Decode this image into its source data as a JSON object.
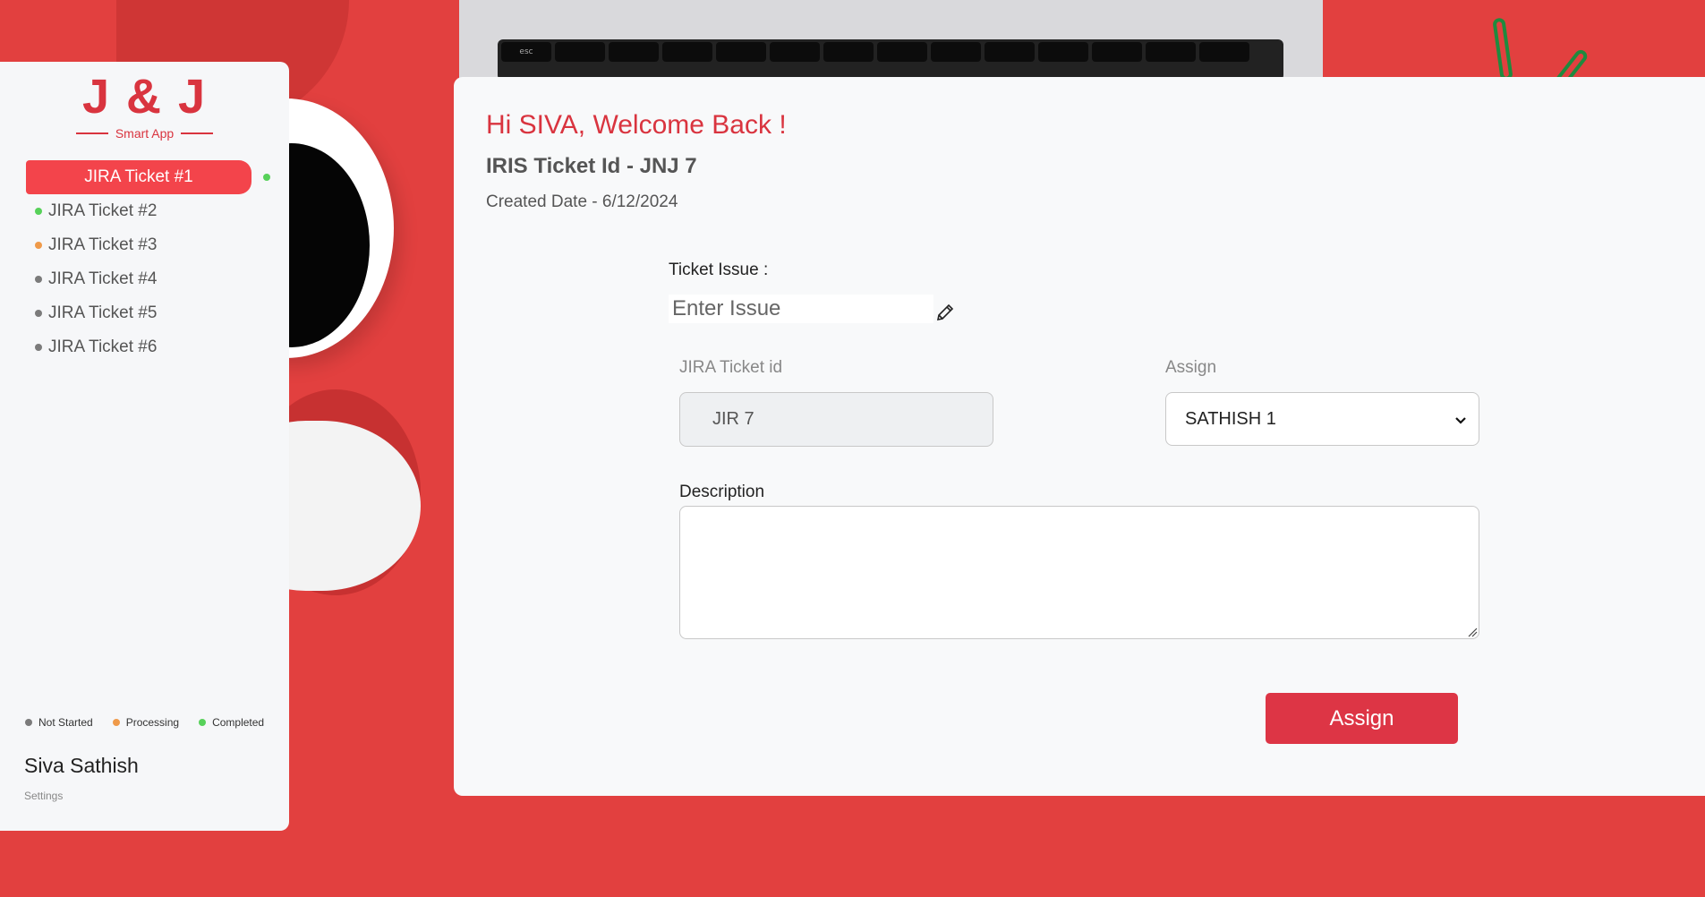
{
  "colors": {
    "accent": "#d9343f",
    "active_item": "#f3444b",
    "not_started": "#7b7b7b",
    "processing": "#ef9a4a",
    "completed": "#57d15a"
  },
  "logo": {
    "title": "J & J",
    "subtitle": "Smart App"
  },
  "sidebar": {
    "items": [
      {
        "label": "JIRA Ticket #1",
        "status": "completed"
      },
      {
        "label": "JIRA Ticket #2",
        "status": "completed"
      },
      {
        "label": "JIRA Ticket #3",
        "status": "processing"
      },
      {
        "label": "JIRA Ticket #4",
        "status": "not_started"
      },
      {
        "label": "JIRA Ticket #5",
        "status": "not_started"
      },
      {
        "label": "JIRA Ticket #6",
        "status": "not_started"
      }
    ],
    "legend": {
      "not_started": "Not Started",
      "processing": "Processing",
      "completed": "Completed"
    },
    "user_name": "Siva Sathish",
    "settings": "Settings"
  },
  "main": {
    "greeting": "Hi SIVA, Welcome Back !",
    "ticket_id": "IRIS Ticket Id - JNJ 7",
    "created_date": "Created Date - 6/12/2024",
    "ticket_issue_label": "Ticket Issue :",
    "ticket_issue_placeholder": "Enter Issue",
    "jira_id_label": "JIRA Ticket id",
    "jira_id_value": "JIR 7",
    "assign_label": "Assign",
    "assign_value": "SATHISH 1",
    "description_label": "Description",
    "description_value": "",
    "assign_button": "Assign"
  }
}
